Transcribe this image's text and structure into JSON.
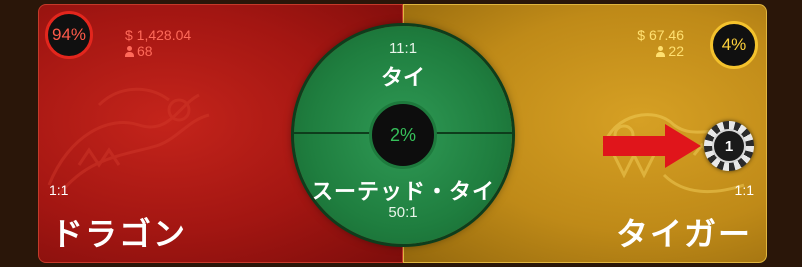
{
  "dragon": {
    "percent": "94%",
    "amount": "$ 1,428.04",
    "players": "68",
    "odds": "1:1",
    "name": "ドラゴン"
  },
  "tiger": {
    "percent": "4%",
    "amount": "$ 67.46",
    "players": "22",
    "odds": "1:1",
    "name": "タイガー"
  },
  "tie": {
    "odds": "11:1",
    "label": "タイ",
    "percent": "2%",
    "suited_label": "スーテッド・タイ",
    "suited_odds": "50:1"
  },
  "chip": {
    "value": "1"
  },
  "colors": {
    "dragon_red": "#b51a14",
    "tiger_gold": "#c99a1e",
    "tie_green": "#24884a",
    "arrow_red": "#e0151b"
  },
  "icons": [
    "person-icon",
    "dragon-emblem-icon",
    "tiger-emblem-icon",
    "arrow-icon",
    "chip-icon"
  ]
}
